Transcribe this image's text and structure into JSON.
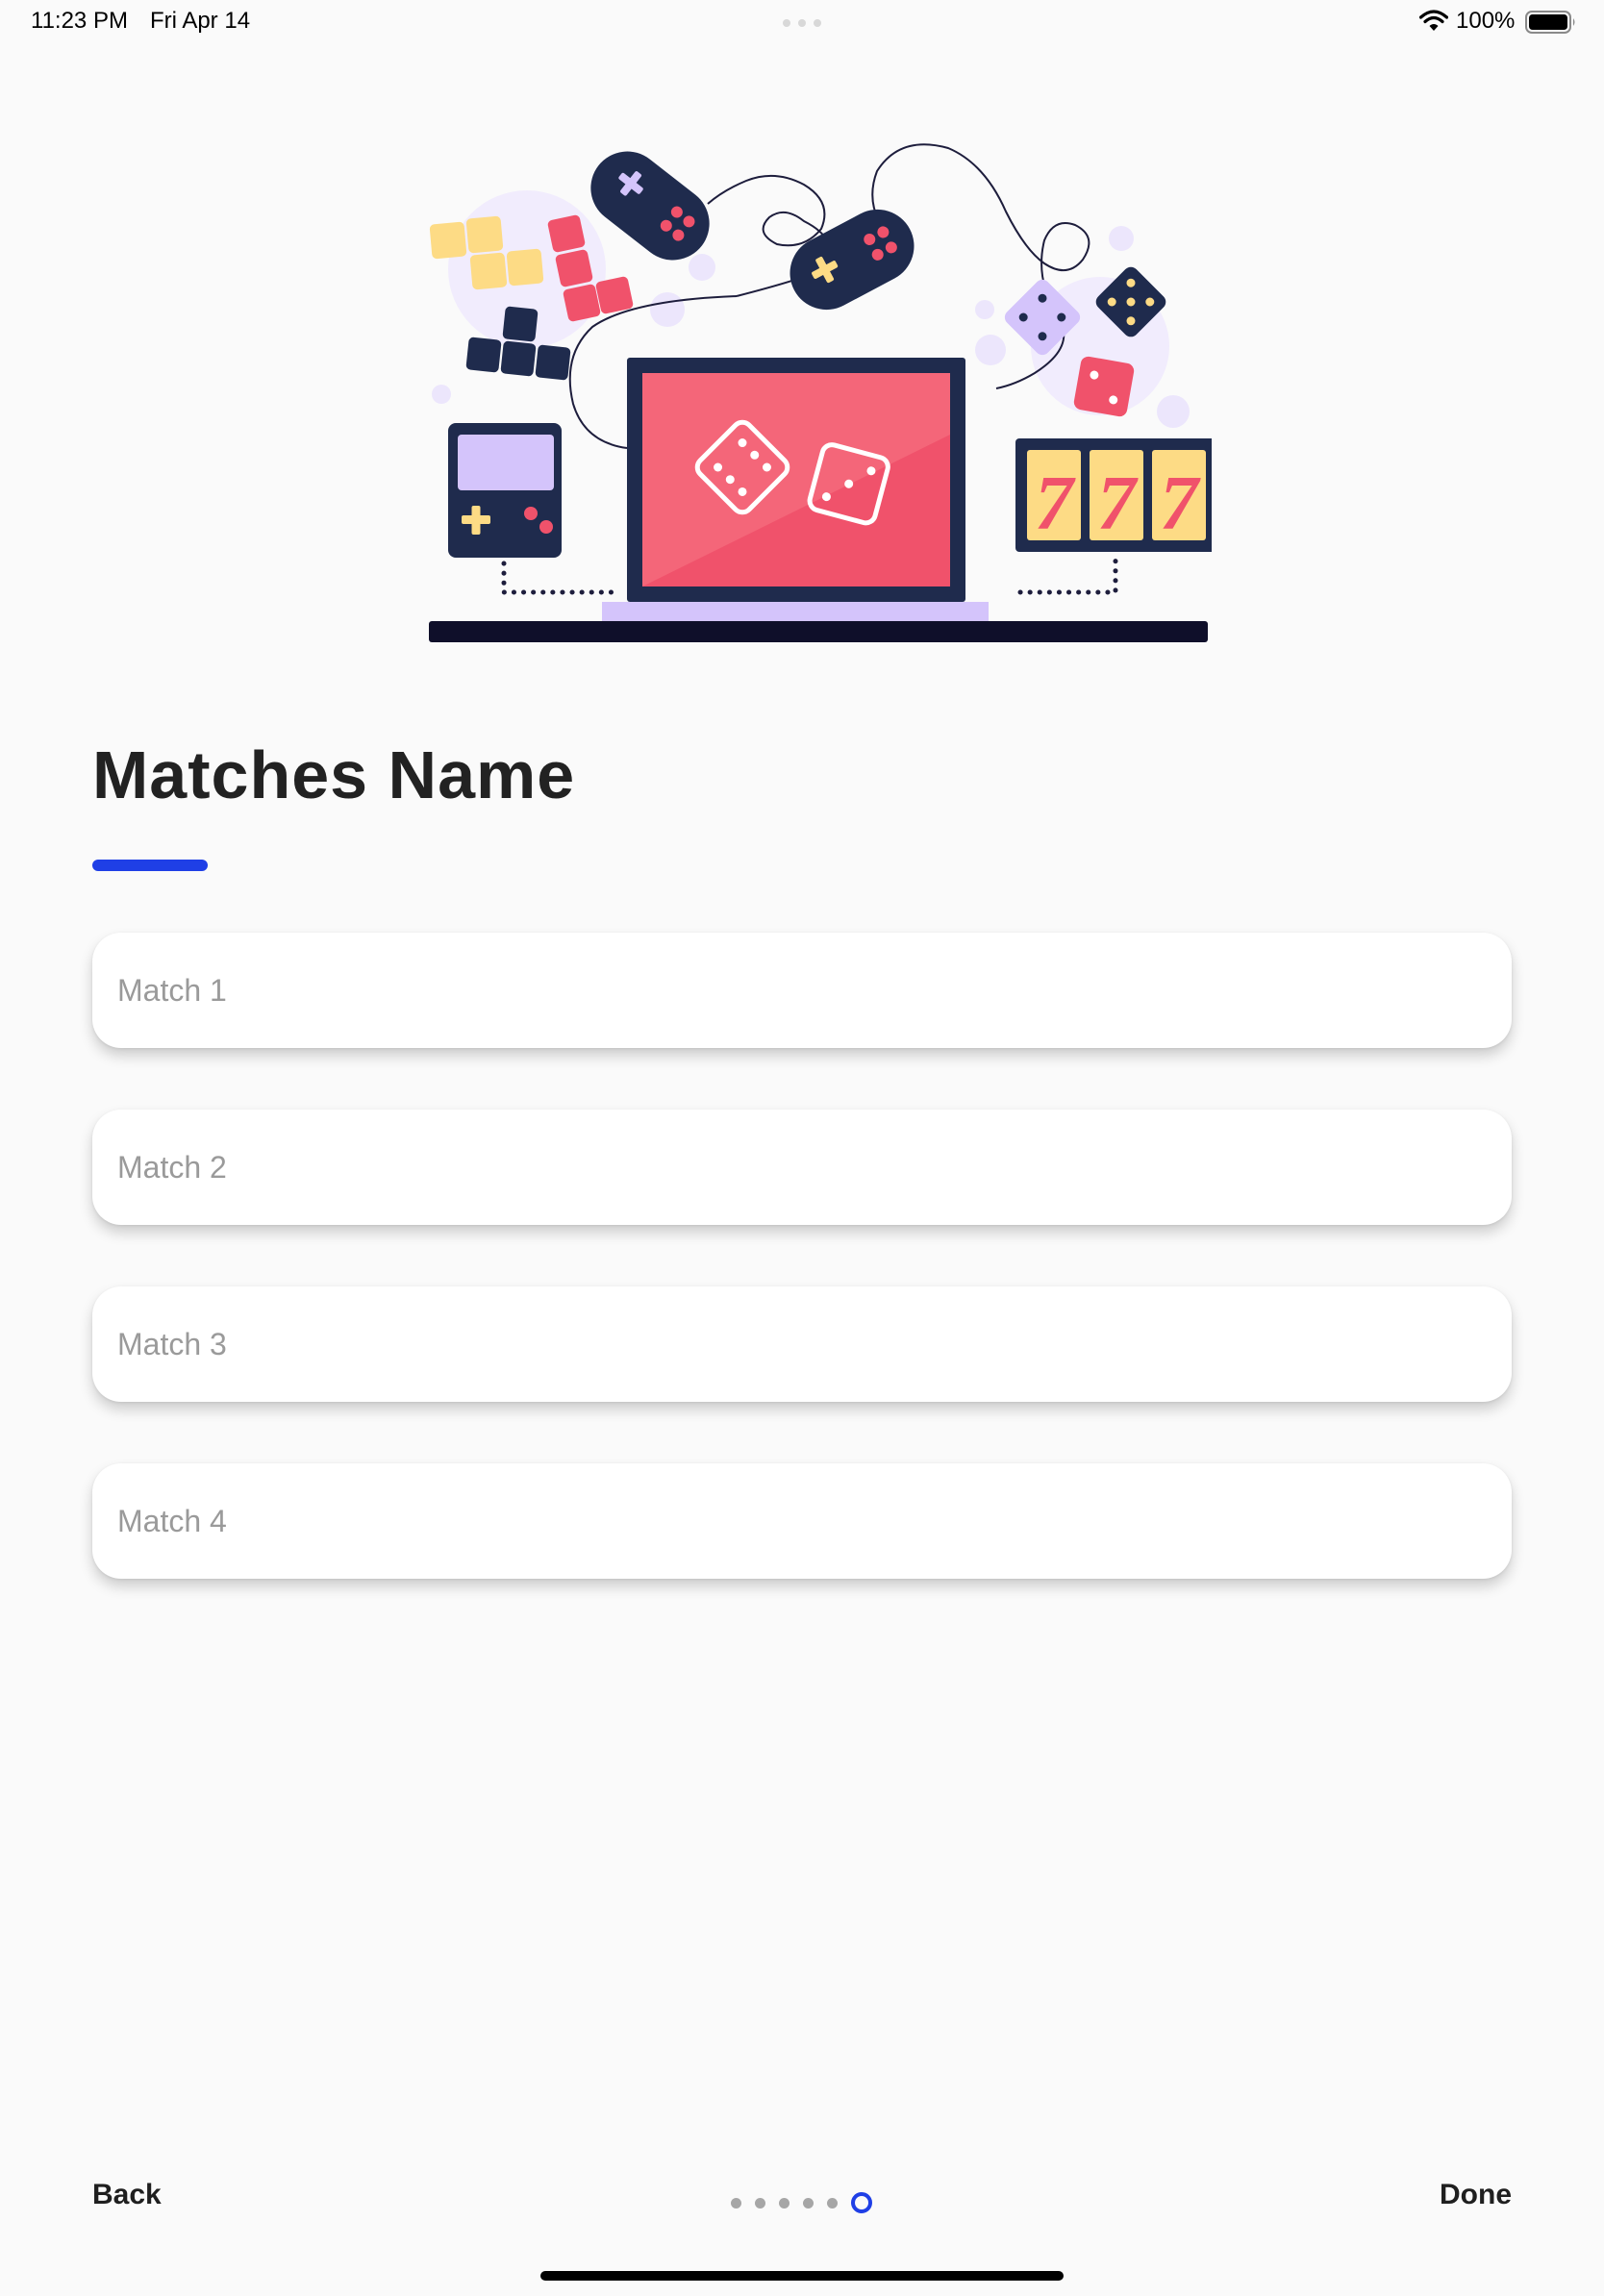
{
  "status_bar": {
    "time": "11:23 PM",
    "date": "Fri Apr 14",
    "battery": "100%"
  },
  "illustration": {
    "icon": "gaming-illustration",
    "slot_digits": [
      "7",
      "7",
      "7"
    ]
  },
  "page": {
    "title": "Matches Name",
    "accent_color": "#1f3fe6"
  },
  "fields": [
    {
      "placeholder": "Match 1",
      "value": ""
    },
    {
      "placeholder": "Match 2",
      "value": ""
    },
    {
      "placeholder": "Match 3",
      "value": ""
    },
    {
      "placeholder": "Match 4",
      "value": ""
    }
  ],
  "navigation": {
    "back_label": "Back",
    "done_label": "Done",
    "total_pages": 6,
    "current_page": 6
  }
}
